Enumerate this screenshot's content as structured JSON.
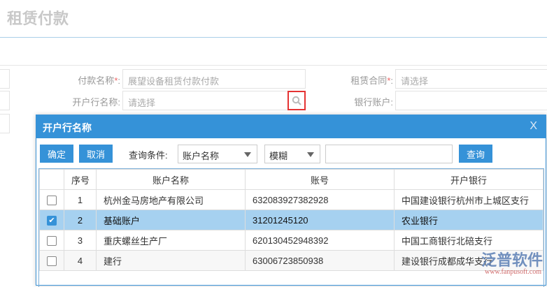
{
  "page": {
    "title": "租赁付款"
  },
  "form": {
    "pay_name_label": "付款名称",
    "pay_name_value": "展望设备租赁付款付款",
    "contract_label": "租赁合同",
    "contract_placeholder": "请选择",
    "bank_name_label": "开户行名称",
    "bank_name_placeholder": "请选择",
    "bank_account_label": "银行账户",
    "required_mark": "*",
    "colon": ":"
  },
  "modal": {
    "title": "开户行名称",
    "close": "X",
    "confirm": "确定",
    "cancel": "取消",
    "query_label": "查询条件:",
    "field_select": "账户名称",
    "mode_select": "模糊",
    "query_button": "查询",
    "columns": [
      "",
      "序号",
      "账户名称",
      "账号",
      "开户银行"
    ],
    "rows": [
      {
        "checked": false,
        "no": "1",
        "name": "杭州金马房地产有限公司",
        "account": "632083927382928",
        "bank": "中国建设银行杭州市上城区支行"
      },
      {
        "checked": true,
        "no": "2",
        "name": "基础账户",
        "account": "31201245120",
        "bank": "农业银行"
      },
      {
        "checked": false,
        "no": "3",
        "name": "重庆螺丝生产厂",
        "account": "620130452948392",
        "bank": "中国工商银行北碚支行"
      },
      {
        "checked": false,
        "no": "4",
        "name": "建行",
        "account": "63006723850938",
        "bank": "建设银行成都成华支行"
      }
    ]
  },
  "watermark": {
    "brand": "泛普软件",
    "url": "www.fanpusoft.com"
  },
  "colors": {
    "accent": "#3592d8",
    "selected_row": "#a6d1f0",
    "highlight": "#e53333"
  }
}
